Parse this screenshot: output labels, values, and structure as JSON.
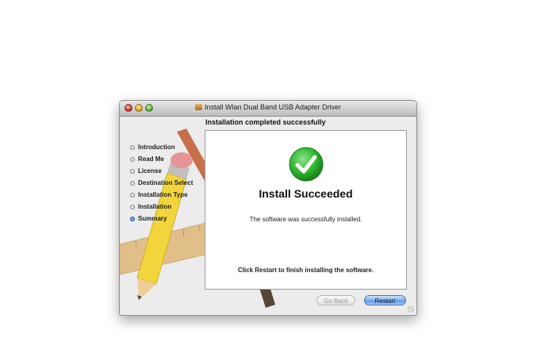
{
  "window": {
    "title": "Install Wlan Dual Band USB Adapter Driver",
    "subtitle": "Installation completed successfully"
  },
  "sidebar": {
    "steps": [
      {
        "label": "Introduction",
        "active": false
      },
      {
        "label": "Read Me",
        "active": false
      },
      {
        "label": "License",
        "active": false
      },
      {
        "label": "Destination Select",
        "active": false
      },
      {
        "label": "Installation Type",
        "active": false
      },
      {
        "label": "Installation",
        "active": false
      },
      {
        "label": "Summary",
        "active": true
      }
    ]
  },
  "panel": {
    "heading": "Install Succeeded",
    "message": "The software was successfully installed.",
    "restart_message": "Click Restart to finish installing the software."
  },
  "buttons": {
    "back": "Go Back",
    "restart": "Restart"
  },
  "colors": {
    "success": "#2db82d",
    "accent": "#5b97e5"
  }
}
